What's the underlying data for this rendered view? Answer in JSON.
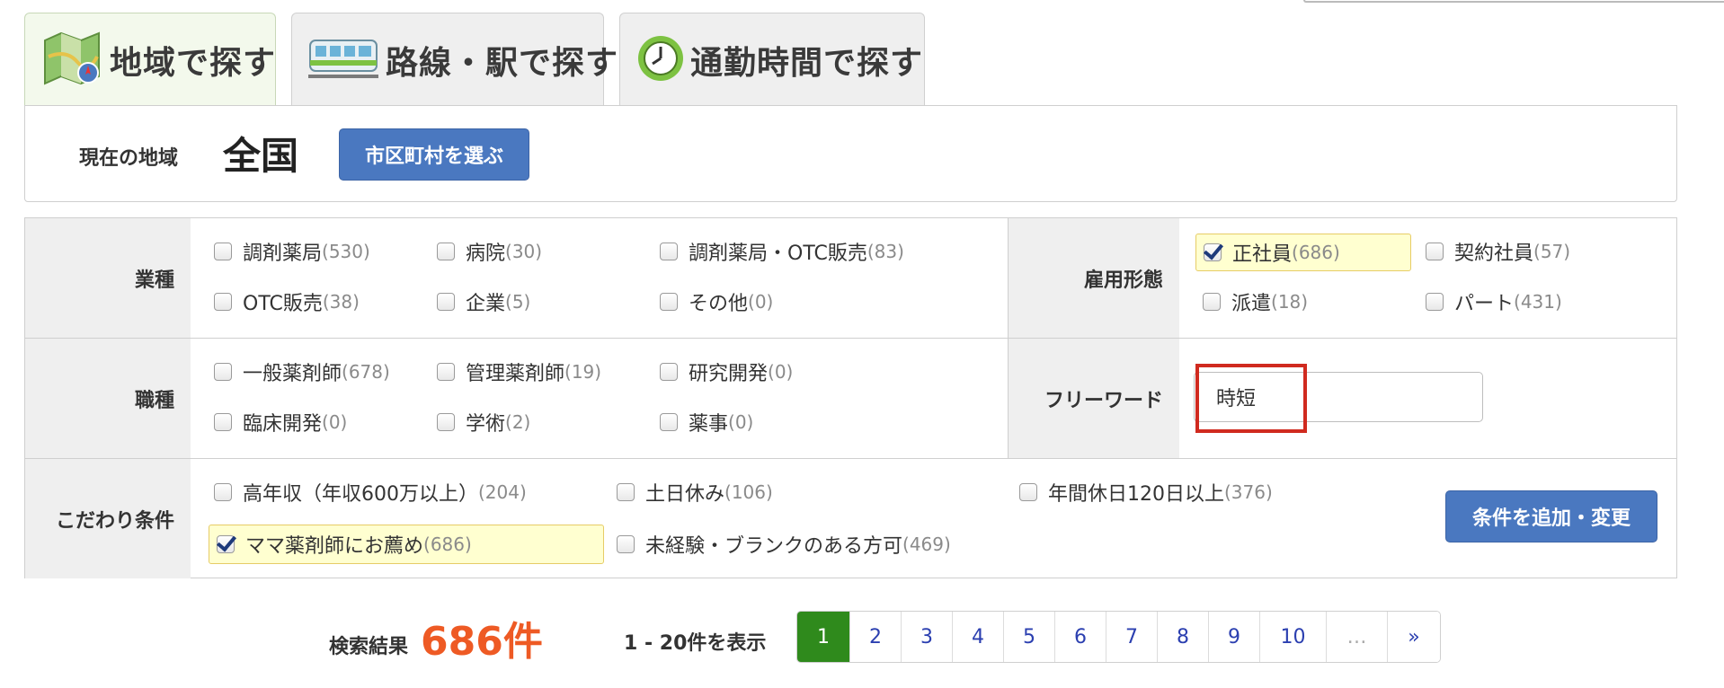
{
  "tabs": [
    {
      "label": "地域で探す",
      "icon": "map-icon",
      "active": true
    },
    {
      "label": "路線・駅で探す",
      "icon": "train-icon",
      "active": false
    },
    {
      "label": "通勤時間で探す",
      "icon": "clock-icon",
      "active": false
    }
  ],
  "region": {
    "label": "現在の地域",
    "value": "全国",
    "select_button": "市区町村を選ぶ"
  },
  "filters": {
    "industry": {
      "label": "業種",
      "options": [
        {
          "label": "調剤薬局",
          "count": "(530)",
          "checked": false
        },
        {
          "label": "病院",
          "count": "(30)",
          "checked": false
        },
        {
          "label": "調剤薬局・OTC販売",
          "count": "(83)",
          "checked": false
        },
        {
          "label": "OTC販売",
          "count": "(38)",
          "checked": false
        },
        {
          "label": "企業",
          "count": "(5)",
          "checked": false
        },
        {
          "label": "その他",
          "count": "(0)",
          "checked": false
        }
      ]
    },
    "employment": {
      "label": "雇用形態",
      "options": [
        {
          "label": "正社員",
          "count": "(686)",
          "checked": true
        },
        {
          "label": "契約社員",
          "count": "(57)",
          "checked": false
        },
        {
          "label": "派遣",
          "count": "(18)",
          "checked": false
        },
        {
          "label": "パート",
          "count": "(431)",
          "checked": false
        }
      ]
    },
    "job_type": {
      "label": "職種",
      "options": [
        {
          "label": "一般薬剤師",
          "count": "(678)",
          "checked": false
        },
        {
          "label": "管理薬剤師",
          "count": "(19)",
          "checked": false
        },
        {
          "label": "研究開発",
          "count": "(0)",
          "checked": false
        },
        {
          "label": "臨床開発",
          "count": "(0)",
          "checked": false
        },
        {
          "label": "学術",
          "count": "(2)",
          "checked": false
        },
        {
          "label": "薬事",
          "count": "(0)",
          "checked": false
        }
      ]
    },
    "freeword": {
      "label": "フリーワード",
      "value": "時短"
    },
    "conditions": {
      "label": "こだわり条件",
      "options": [
        {
          "label": "高年収（年収600万以上）",
          "count": "(204)",
          "checked": false
        },
        {
          "label": "土日休み",
          "count": "(106)",
          "checked": false
        },
        {
          "label": "年間休日120日以上",
          "count": "(376)",
          "checked": false
        },
        {
          "label": "ママ薬剤師にお薦め",
          "count": "(686)",
          "checked": true
        },
        {
          "label": "未経験・ブランクのある方可",
          "count": "(469)",
          "checked": false
        }
      ],
      "button": "条件を追加・変更"
    }
  },
  "results": {
    "label": "検索結果",
    "count": "686件",
    "range": "1 - 20件を表示"
  },
  "pagination": {
    "pages": [
      "1",
      "2",
      "3",
      "4",
      "5",
      "6",
      "7",
      "8",
      "9",
      "10",
      "…",
      "»"
    ],
    "current": "1"
  },
  "colors": {
    "accent_blue": "#4a78c0",
    "result_orange": "#ee5a24",
    "page_current_green": "#2f8a1c",
    "highlight_red": "#d02a1f"
  }
}
